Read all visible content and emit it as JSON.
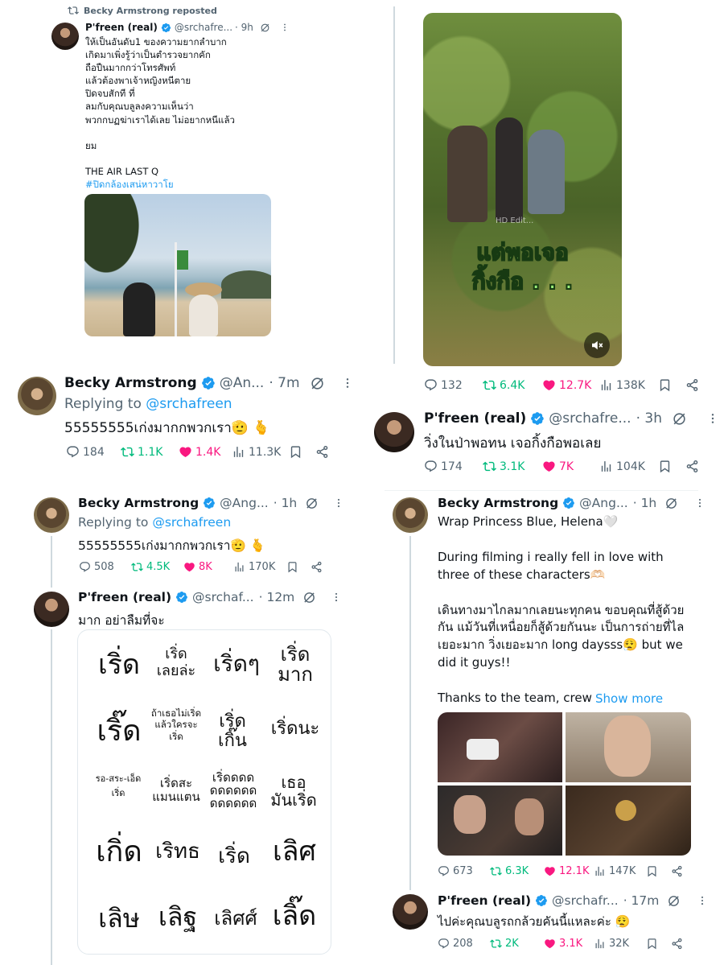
{
  "tweet1": {
    "repost_label": "Becky Armstrong reposted",
    "name": "P'freen (real)",
    "handle": "@srchafre...",
    "time": "· 9h",
    "text": "ให้เป็นอันดับ1 ของความยากลำบาก\nเกิดมาเพิ่งรู้ว่าเป็นตำรวจยากคัก\nถือปืนมากกว่าโทรศัพท์\nแล้วต้องพาเจ้าหญิงหนีตาย\nปิดจบสักที ที่\nลมกับคุณบลูลงความเห็นว่า\nพวกกบฏฆ่าเราได้เลย ไม่อยากหนีแล้ว\n\nยม\n\nTHE AIR LAST Q",
    "hashtag": "#ปิดกล้องเสน่หาวาโย"
  },
  "tweet2": {
    "name": "Becky Armstrong",
    "handle": "@An...",
    "time": "· 7m",
    "replying_prefix": "Replying to",
    "replying_to": "@srchafreen",
    "text": "55555555เก่งมากกพวกเรา🫡 🫰",
    "replies": "184",
    "reposts": "1.1K",
    "likes": "1.4K",
    "views": "11.3K"
  },
  "tweet3": {
    "name": "Becky Armstrong",
    "handle": "@Ang...",
    "time": "· 1h",
    "replying_prefix": "Replying to",
    "replying_to": "@srchafreen",
    "text": "55555555เก่งมากกพวกเรา🫡 🫰",
    "replies": "508",
    "reposts": "4.5K",
    "likes": "8K",
    "views": "170K"
  },
  "tweet4": {
    "name": "P'freen (real)",
    "handle": "@srchaf...",
    "time": "· 12m",
    "text": "มาก อย่าลืมที่จะ",
    "words": [
      "เริ่ด",
      "เริ่ด\nเลยล่ะ",
      "เริ่ดๆ",
      "เริ่ด\nมาก",
      "เริ๊ด",
      "ถ้าเธอไม่เริ่ด\nแล้วใครจะ\nเริ่ด",
      "เริ่ด\nเกิ๊น",
      "เริ่ดนะ",
      "รอ-สระ-เอ็ด\nเริ่ด",
      "เริ่ดสะ\nแมนแตน",
      "เริ่ดดดด\nดดดดดด\nดดดดดด",
      "เธอ\nมันเริ่ด",
      "เกิ่ด",
      "เริทธ",
      "เริ่ด",
      "เลิศ",
      "เลิษ",
      "เลิฐ",
      "เลิศศ์",
      "เลิ๊ด"
    ]
  },
  "tweet5": {
    "video_caption": "แต่พอเจอ\nกิ้งกือ . . .",
    "watermark": "HD Edit...",
    "replies": "132",
    "reposts": "6.4K",
    "likes": "12.7K",
    "views": "138K"
  },
  "tweet6": {
    "name": "P'freen (real)",
    "handle": "@srchafre...",
    "time": "· 3h",
    "text": "วิ่งในป่าพอทน เจอกิ้งกือพอเลย",
    "replies": "174",
    "reposts": "3.1K",
    "likes": "7K",
    "views": "104K"
  },
  "tweet7": {
    "name": "Becky Armstrong",
    "handle": "@Ang...",
    "time": "· 1h",
    "text": "Wrap Princess Blue, Helena🤍\n\nDuring filming i really fell in love with three of these characters🫶🏻\n\nเดินทางมาไกลมากเลยนะทุกคน ขอบคุณที่สู้ด้วยกัน แม้วันที่เหนื่อยก็สู้ด้วยกันนะ เป็นการถ่ายที่ไลเยอะมาก วิ่งเยอะมาก long daysss😮‍💨 but we did it guys!!\n\nThanks to the team, crew",
    "show_more": "Show more",
    "replies": "673",
    "reposts": "6.3K",
    "likes": "12.1K",
    "views": "147K"
  },
  "tweet8": {
    "name": "P'freen (real)",
    "handle": "@srchafr...",
    "time": "· 17m",
    "text": "ไปค่ะคุณบลูรถกล้วยคันนี้แหละค่ะ 😮‍💨",
    "replies": "208",
    "reposts": "2K",
    "likes": "3.1K",
    "views": "32K"
  },
  "colors": {
    "accent": "#1d9bf0",
    "repost": "#00ba7c",
    "like": "#f91880",
    "muted": "#536471"
  }
}
